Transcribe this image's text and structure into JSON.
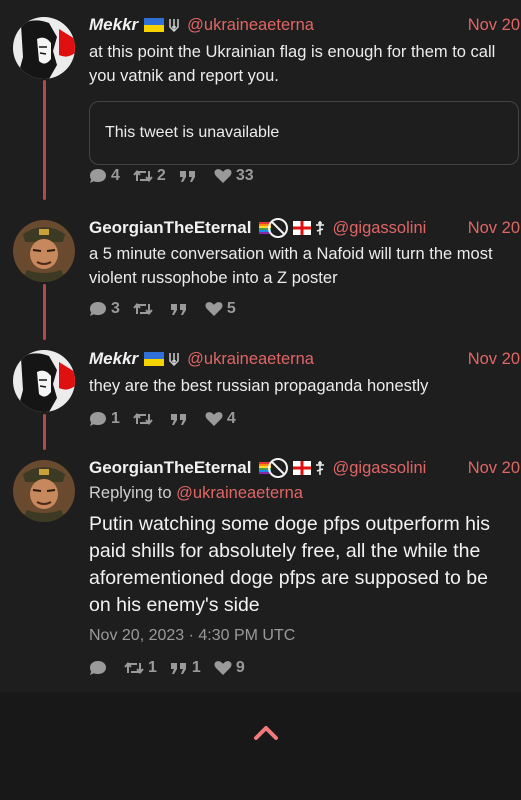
{
  "tweets": [
    {
      "name": "Mekkr",
      "handle": "@ukraineaeterna",
      "date": "Nov 20",
      "text": "at this point the Ukrainian flag is enough for them to call you vatnik and report you.",
      "quote": "This tweet is unavailable",
      "replies": "4",
      "retweets": "2",
      "quotes": "",
      "likes": "33"
    },
    {
      "name": "GeorgianTheEternal",
      "handle": "@gigassolini",
      "date": "Nov 20",
      "text": "a 5 minute conversation with a Nafoid will turn the most violent russophobe into a Z poster",
      "replies": "3",
      "retweets": "",
      "quotes": "",
      "likes": "5"
    },
    {
      "name": "Mekkr",
      "handle": "@ukraineaeterna",
      "date": "Nov 20",
      "text": "they are the best russian propaganda honestly",
      "replies": "1",
      "retweets": "",
      "quotes": "",
      "likes": "4"
    },
    {
      "name": "GeorgianTheEternal",
      "handle": "@gigassolini",
      "date": "Nov 20",
      "replying_prefix": "Replying to ",
      "replying_handle": "@ukraineaeterna",
      "text": "Putin watching some doge pfps outperform his paid shills for absolutely free, all the while the aforementioned doge pfps are supposed to be on his enemy's side",
      "timestamp": "Nov 20, 2023 · 4:30 PM UTC",
      "replies": "",
      "retweets": "1",
      "quotes": "1",
      "likes": "9"
    }
  ],
  "icons": {
    "reply": "speech-bubble-icon",
    "retweet": "retweet-icon",
    "quote": "quote-icon",
    "like": "heart-icon",
    "top": "chevron-up-icon"
  },
  "colors": {
    "accent": "#e06666",
    "background": "#1e1e1e",
    "thread_line": "#b14a4a"
  }
}
